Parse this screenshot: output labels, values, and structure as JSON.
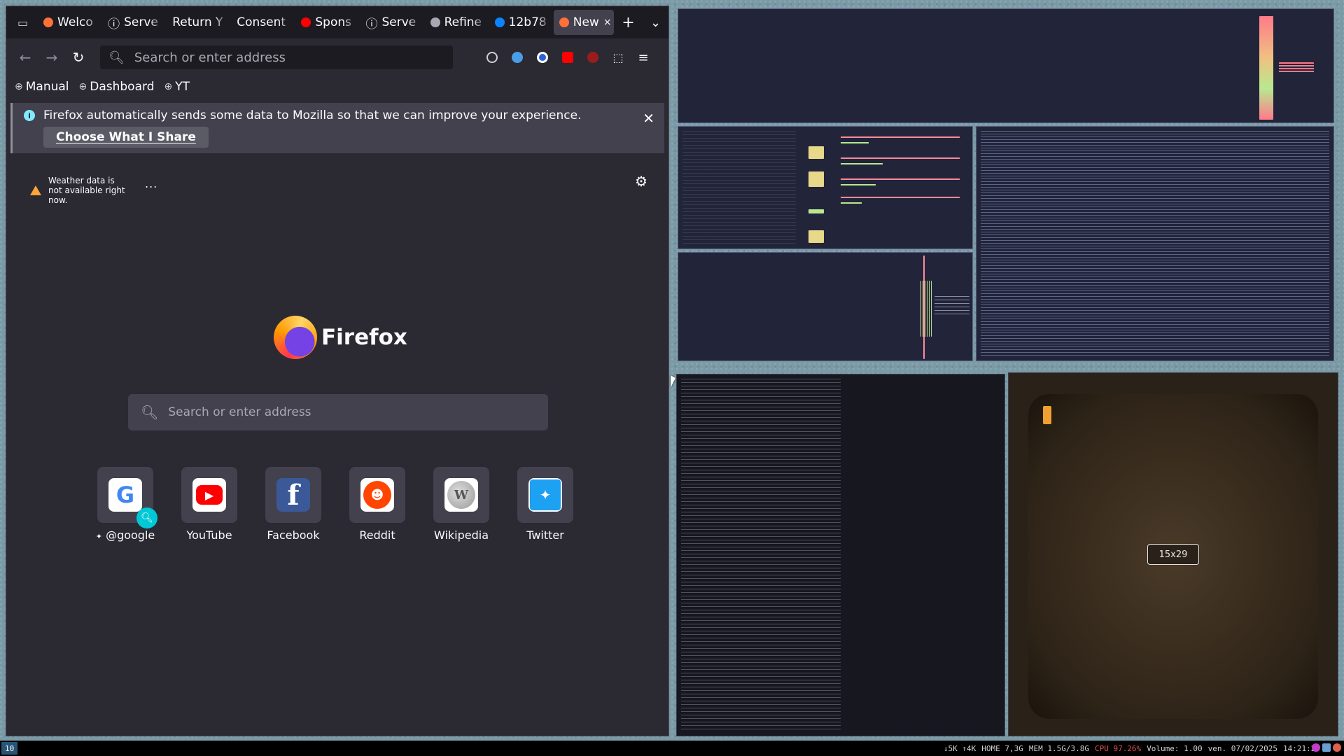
{
  "browser": {
    "tabs": [
      {
        "label": "Welco",
        "icon_color": "#ff7139"
      },
      {
        "label": "Serve",
        "icon": "info-icon"
      },
      {
        "label": "Return Y",
        "icon": "none"
      },
      {
        "label": "Consent",
        "icon": "none"
      },
      {
        "label": "Spons",
        "icon_color": "#ff0000"
      },
      {
        "label": "Serve",
        "icon": "info-icon"
      },
      {
        "label": "Refine",
        "icon_color": "#a8a8b3"
      },
      {
        "label": "12b78",
        "icon_color": "#0a84ff"
      }
    ],
    "active_tab": {
      "label": "New",
      "icon_color": "#ff7139"
    },
    "tab_close": "×",
    "new_tab": "+",
    "tab_list": "⌄",
    "address_placeholder": "Search or enter address",
    "bookmarks": [
      "Manual",
      "Dashboard",
      "YT"
    ],
    "notification": {
      "text": "Firefox automatically sends some data to Mozilla so that we can improve your experience.",
      "button": "Choose What I Share",
      "close": "✕"
    },
    "newtab": {
      "weather": "Weather data is not available right now.",
      "more": "...",
      "brand": "Firefox",
      "search_placeholder": "Search or enter address",
      "shortcuts": [
        {
          "label": "@google",
          "letter": "G",
          "bg": "#ffffff",
          "fg": "#4285f4"
        },
        {
          "label": "YouTube",
          "letter": "▶",
          "bg": "#ff0000",
          "fg": "#ffffff"
        },
        {
          "label": "Facebook",
          "letter": "f",
          "bg": "#3b5998",
          "fg": "#ffffff"
        },
        {
          "label": "Reddit",
          "letter": "●",
          "bg": "#ff4500",
          "fg": "#ffffff"
        },
        {
          "label": "Wikipedia",
          "letter": "W",
          "bg": "#e8e8e8",
          "fg": "#333333"
        },
        {
          "label": "Twitter",
          "letter": "🐦",
          "bg": "#1da1f2",
          "fg": "#ffffff"
        }
      ],
      "google_pin": "✦"
    }
  },
  "overlay": {
    "size_label": "15x29"
  },
  "statusbar": {
    "workspace": "10",
    "net": "↓5K ↑4K",
    "home": "HOME 7,3G",
    "mem": "MEM 1.5G/3.8G",
    "cpu": "CPU 97.26%",
    "volume": "Volume: 1.00",
    "date": "ven. 07/02/2025",
    "time": "14:21:29"
  },
  "colors": {
    "accent": "#0a84ff",
    "cpu_warning": "#e05050",
    "workspace": "#285577"
  }
}
